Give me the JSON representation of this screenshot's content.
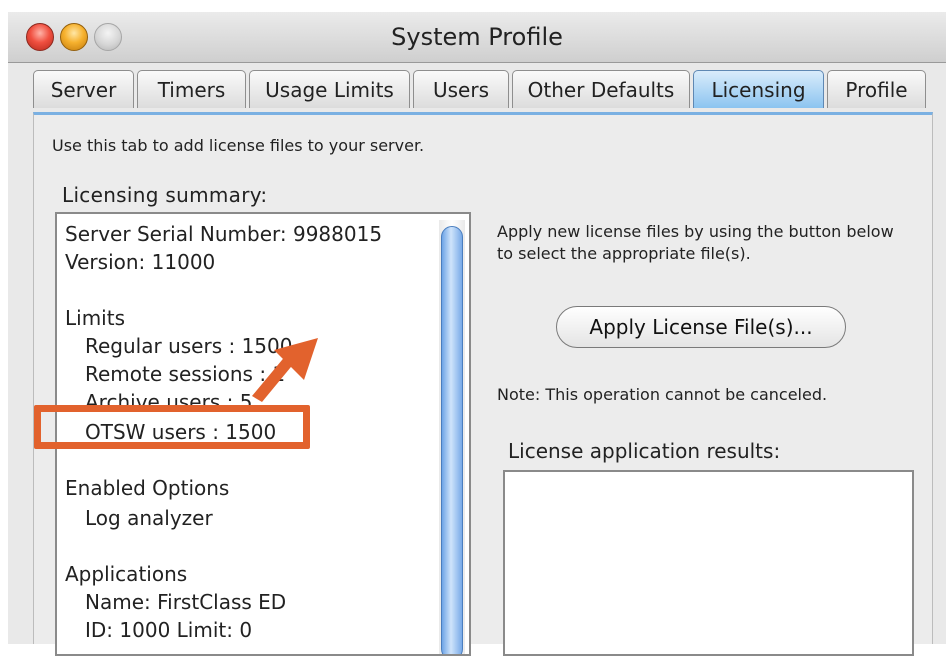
{
  "window": {
    "title": "System Profile"
  },
  "tabs": [
    {
      "label": "Server"
    },
    {
      "label": "Timers"
    },
    {
      "label": "Usage Limits"
    },
    {
      "label": "Users"
    },
    {
      "label": "Other Defaults"
    },
    {
      "label": "Licensing"
    },
    {
      "label": "Profile"
    }
  ],
  "active_tab": "Licensing",
  "panel": {
    "intro": "Use this tab to add license files to your server.",
    "summary_heading": "Licensing summary:",
    "summary_lines": [
      "Server Serial Number: 9988015",
      "Version:  11000",
      "Limits",
      "Regular users : 1500",
      "Remote sessions : 1",
      "Archive users : 5",
      "OTSW users : 1500",
      "Enabled Options",
      "Log analyzer",
      "Applications",
      "Name: FirstClass ED",
      "ID: 1000     Limit: 0"
    ],
    "apply_note_line1": "Apply new license files by using the button below",
    "apply_note_line2": "to select the appropriate file(s).",
    "apply_button": "Apply License File(s)...",
    "cancel_note": "Note: This operation cannot be canceled.",
    "results_heading": "License application results:"
  },
  "colors": {
    "highlight": "#e2622d",
    "active_tab": "#8cc4f0",
    "scroll_thumb": "#6ea4e6"
  }
}
